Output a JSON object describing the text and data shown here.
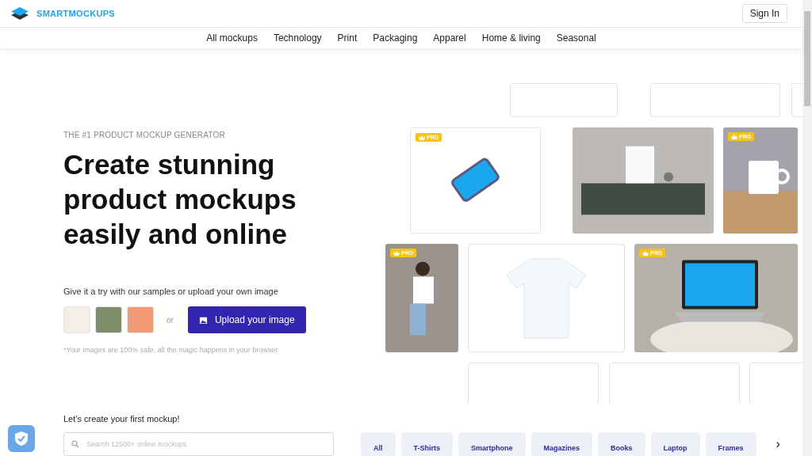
{
  "header": {
    "logo_text": "SMARTMOCKUPS",
    "sign_in": "Sign In"
  },
  "nav": [
    "All mockups",
    "Technology",
    "Print",
    "Packaging",
    "Apparel",
    "Home & living",
    "Seasonal"
  ],
  "hero": {
    "eyebrow": "THE #1 PRODUCT MOCKUP GENERATOR",
    "title_lines": [
      "Create stunning",
      "product mockups",
      "easily and online"
    ],
    "try_text": "Give it a try with our samples or upload your own image",
    "or_text": "or",
    "upload_button": "Upload your image",
    "note": "*Your images are 100% safe, all the magic happens in your browser"
  },
  "gallery": [
    [
      {
        "kind": "blank"
      },
      {
        "kind": "blank"
      },
      {
        "kind": "blank"
      }
    ],
    [
      {
        "kind": "phone",
        "badge": "PRO"
      },
      {
        "kind": "room"
      },
      {
        "kind": "mug",
        "badge": "PRO"
      }
    ],
    [
      {
        "kind": "person",
        "badge": "PRO"
      },
      {
        "kind": "tshirt"
      },
      {
        "kind": "laptop",
        "badge": "PRO"
      }
    ],
    [
      {
        "kind": "blank"
      },
      {
        "kind": "blank"
      },
      {
        "kind": "blank"
      }
    ]
  ],
  "create": {
    "title": "Let’s create your first mockup!",
    "search_placeholder": "Search 12500+ online mockups",
    "categories": [
      "All",
      "T-Shirts",
      "Smartphone",
      "Magazines",
      "Books",
      "Laptop",
      "Frames"
    ],
    "next_arrow": "›"
  }
}
